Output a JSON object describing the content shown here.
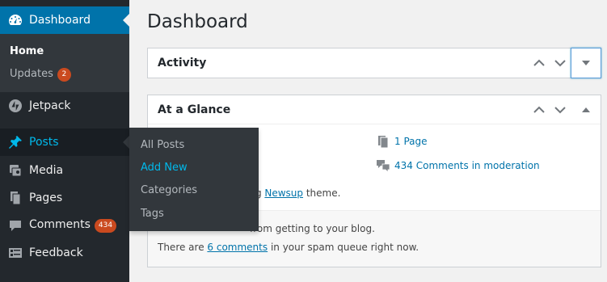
{
  "sidebar": {
    "dashboard": {
      "label": "Dashboard",
      "icon": "dashboard-icon"
    },
    "submenu": {
      "home": "Home",
      "updates": "Updates",
      "updates_count": "2"
    },
    "jetpack": {
      "label": "Jetpack",
      "icon": "jetpack-icon"
    },
    "posts": {
      "label": "Posts",
      "icon": "pin-icon"
    },
    "media": {
      "label": "Media",
      "icon": "media-icon"
    },
    "pages": {
      "label": "Pages",
      "icon": "pages-icon"
    },
    "comments": {
      "label": "Comments",
      "icon": "comment-icon",
      "count": "434"
    },
    "feedback": {
      "label": "Feedback",
      "icon": "feedback-icon"
    }
  },
  "flyout": {
    "items": [
      "All Posts",
      "Add New",
      "Categories",
      "Tags"
    ],
    "current": "Add New"
  },
  "main": {
    "title": "Dashboard",
    "activity": {
      "title": "Activity"
    },
    "glance": {
      "title": "At a Glance",
      "pages": "1 Page",
      "comments_moderation": "434 Comments in moderation",
      "theme_text_partial": "ing ",
      "theme_link": "Newsup",
      "theme_suffix": " theme.",
      "blog_text_partial": "from getting to your blog.",
      "spam_prefix": "There are ",
      "spam_link": "6 comments",
      "spam_suffix": " in your spam queue right now."
    }
  },
  "colors": {
    "sidebar_bg": "#23282d",
    "accent": "#0073aa",
    "active_text": "#00b9eb",
    "badge": "#ca4a1f"
  }
}
